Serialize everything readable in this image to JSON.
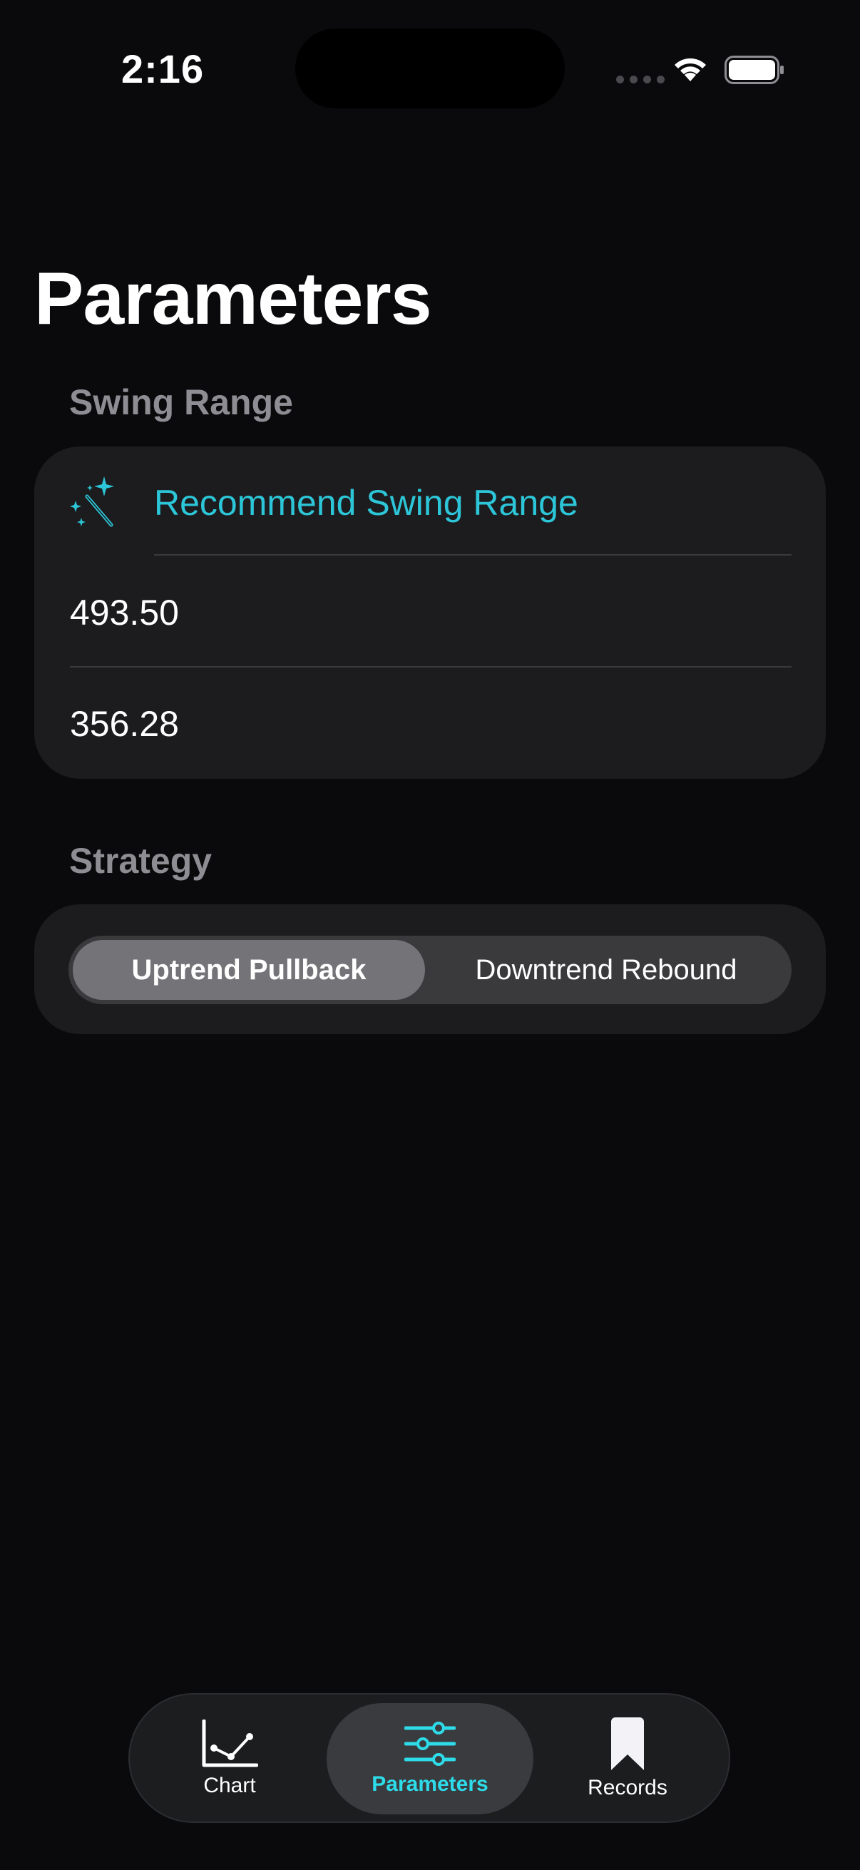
{
  "status_bar": {
    "time": "2:16"
  },
  "page": {
    "title": "Parameters"
  },
  "swing_range": {
    "header": "Swing Range",
    "recommend_label": "Recommend Swing Range",
    "upper_value": "493.50",
    "lower_value": "356.28"
  },
  "strategy": {
    "header": "Strategy",
    "options": [
      "Uptrend Pullback",
      "Downtrend Rebound"
    ],
    "selected": "Uptrend Pullback"
  },
  "tab_bar": {
    "tabs": [
      {
        "label": "Chart",
        "icon": "chart-line-icon"
      },
      {
        "label": "Parameters",
        "icon": "sliders-icon"
      },
      {
        "label": "Records",
        "icon": "bookmark-icon"
      }
    ],
    "active": "Parameters"
  },
  "colors": {
    "accent": "#2cc6d8",
    "background": "#0a0a0c",
    "card": "#1c1c1e",
    "secondary_text": "#8d8d93"
  }
}
